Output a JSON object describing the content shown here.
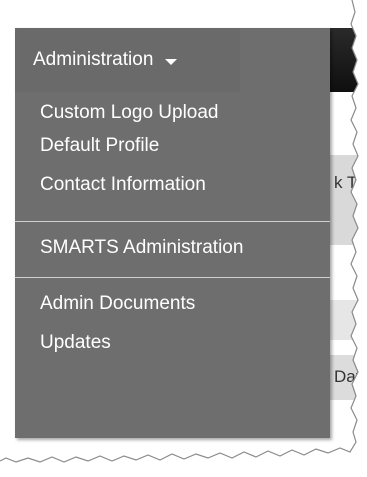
{
  "menu": {
    "title": "Administration",
    "group1": [
      "Custom Logo Upload",
      "Default Profile",
      "Contact Information"
    ],
    "group2": [
      "SMARTS Administration"
    ],
    "group3": [
      "Admin Documents",
      "Updates"
    ]
  },
  "background": {
    "fragment1": "k T",
    "fragment2": "Date"
  },
  "colors": {
    "menu_bg": "#6e6e6e",
    "navbar": "#1a1a1a",
    "text": "#ffffff"
  }
}
